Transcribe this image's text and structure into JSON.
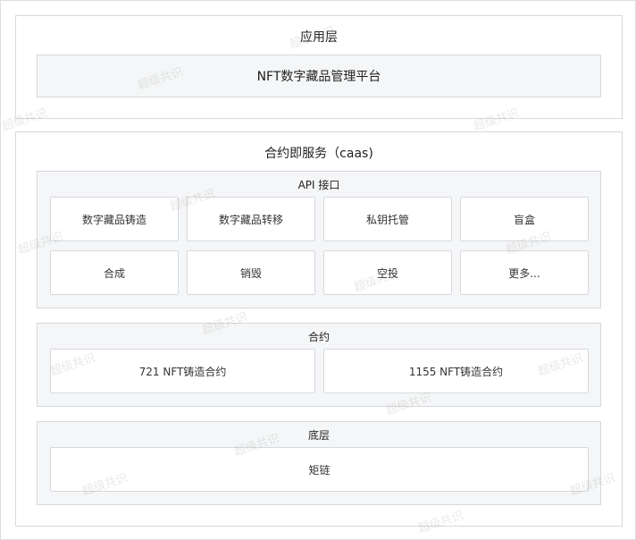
{
  "application_layer": {
    "title": "应用层",
    "platform": "NFT数字藏品管理平台"
  },
  "caas_layer": {
    "title": "合约即服务（caas)",
    "api": {
      "title": "API 接口",
      "row1": [
        "数字藏品铸造",
        "数字藏品转移",
        "私钥托管",
        "盲盒"
      ],
      "row2": [
        "合成",
        "销毁",
        "空投",
        "更多..."
      ]
    },
    "contracts": {
      "title": "合约",
      "items": [
        "721 NFT铸造合约",
        "1155 NFT铸造合约"
      ]
    },
    "base": {
      "title": "底层",
      "items": [
        "矩链"
      ]
    }
  },
  "watermark": "超级共识"
}
